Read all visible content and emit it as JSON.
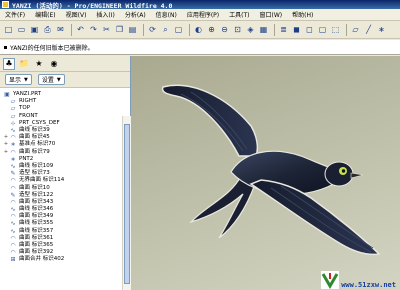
{
  "titlebar": {
    "title": "YANZI (活动的) - Pro/ENGINEER Wildfire 4.0"
  },
  "menu": [
    "文件(F)",
    "编辑(E)",
    "视图(V)",
    "插入(I)",
    "分析(A)",
    "信息(N)",
    "应用程序(P)",
    "工具(T)",
    "窗口(W)",
    "帮助(H)"
  ],
  "toolbar_icons": [
    "new-file-icon",
    "open-folder-icon",
    "save-icon",
    "print-icon",
    "email-icon",
    "sep",
    "undo-icon",
    "redo-icon",
    "cut-icon",
    "copy-icon",
    "paste-icon",
    "sep",
    "regenerate-icon",
    "find-icon",
    "select-icon",
    "sep",
    "repaint-icon",
    "zoom-in-icon",
    "zoom-out-icon",
    "refit-icon",
    "orient-icon",
    "saved-views-icon",
    "sep",
    "layers-icon",
    "shading-icon",
    "hidden-line-icon",
    "no-hidden-icon",
    "wireframe-icon",
    "sep",
    "datum-plane-icon",
    "datum-axis-icon",
    "datum-point-icon"
  ],
  "message": "YANZI的任何旧版本已被删除。",
  "nav": {
    "filters": {
      "show": "显示",
      "settings": "设置"
    }
  },
  "tree": [
    {
      "label": "YANZI.PRT",
      "icon": "part-icon",
      "exp": ""
    },
    {
      "label": "RIGHT",
      "icon": "datum-plane-icon",
      "exp": ""
    },
    {
      "label": "TOP",
      "icon": "datum-plane-icon",
      "exp": ""
    },
    {
      "label": "FRONT",
      "icon": "datum-plane-icon",
      "exp": ""
    },
    {
      "label": "PRT_CSYS_DEF",
      "icon": "csys-icon",
      "exp": ""
    },
    {
      "label": "曲线 标识39",
      "icon": "curve-icon",
      "exp": ""
    },
    {
      "label": "曲面 标识45",
      "icon": "surface-icon",
      "exp": "+"
    },
    {
      "label": "基准点 标识70",
      "icon": "datum-point-icon",
      "exp": "+"
    },
    {
      "label": "曲面 标识79",
      "icon": "surface-icon",
      "exp": "+"
    },
    {
      "label": "PNT2",
      "icon": "datum-point-icon",
      "exp": ""
    },
    {
      "label": "曲线 标识109",
      "icon": "curve-icon",
      "exp": ""
    },
    {
      "label": "造型 标识73",
      "icon": "style-icon",
      "exp": ""
    },
    {
      "label": "无界曲面 标识114",
      "icon": "surface-icon",
      "exp": ""
    },
    {
      "label": "曲面 标识10",
      "icon": "surface-icon",
      "exp": ""
    },
    {
      "label": "造型 标识122",
      "icon": "style-icon",
      "exp": ""
    },
    {
      "label": "曲面 标识343",
      "icon": "surface-icon",
      "exp": ""
    },
    {
      "label": "曲线 标识346",
      "icon": "curve-icon",
      "exp": ""
    },
    {
      "label": "曲面 标识349",
      "icon": "surface-icon",
      "exp": ""
    },
    {
      "label": "曲线 标识355",
      "icon": "curve-icon",
      "exp": ""
    },
    {
      "label": "曲线 标识357",
      "icon": "curve-icon",
      "exp": ""
    },
    {
      "label": "曲面 标识361",
      "icon": "surface-icon",
      "exp": ""
    },
    {
      "label": "曲面 标识365",
      "icon": "surface-icon",
      "exp": ""
    },
    {
      "label": "曲面 标识392",
      "icon": "surface-icon",
      "exp": ""
    },
    {
      "label": "曲面合并 标识402",
      "icon": "merge-icon",
      "exp": ""
    }
  ],
  "watermark": {
    "text": "www.51zxw.net"
  },
  "colors": {
    "viewport_bg": "#bdbea8",
    "model": "#1d2436",
    "eye_ring": "#c8e04a"
  }
}
